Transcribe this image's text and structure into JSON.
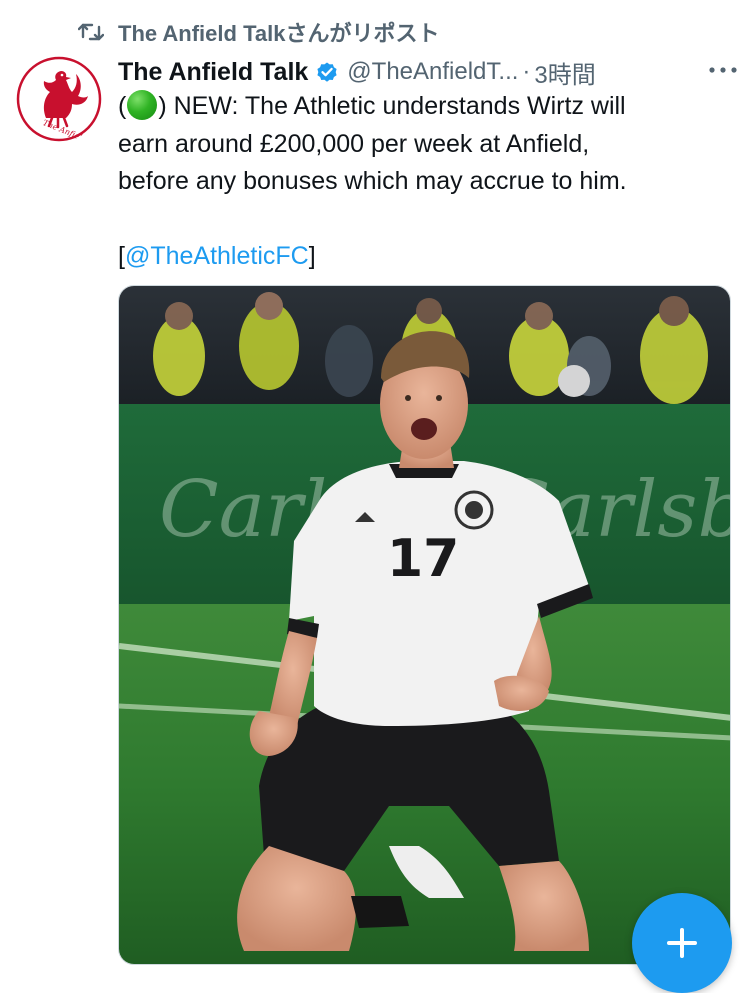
{
  "repost": {
    "label": "The Anfield Talkさんがリポスト",
    "icon": "repost-icon"
  },
  "tweet": {
    "display_name": "The Anfield Talk",
    "handle": "@TheAnfieldT...",
    "separator": "·",
    "time": "3時間",
    "verified": true,
    "verified_color": "#1d9bf0",
    "text_lines": {
      "line1_open": "(",
      "line1_after_dot": ") NEW: The Athletic understands Wirtz will",
      "line2": "earn around £200,000 per week at Anfield,",
      "line3": "before any bonuses which may accrue to him.",
      "bracket_open": "[",
      "mention": "@TheAthleticFC",
      "bracket_close": "]"
    },
    "emoji": "green-circle",
    "avatar_text": "The Anfield Talk",
    "accent_color": "#1d9bf0",
    "brand_red": "#c8102e"
  },
  "media": {
    "shirt_number": "17",
    "board_text_left": "Carlsberg",
    "board_text_right": "Carlsberg"
  },
  "fab": {
    "icon": "plus-icon"
  }
}
